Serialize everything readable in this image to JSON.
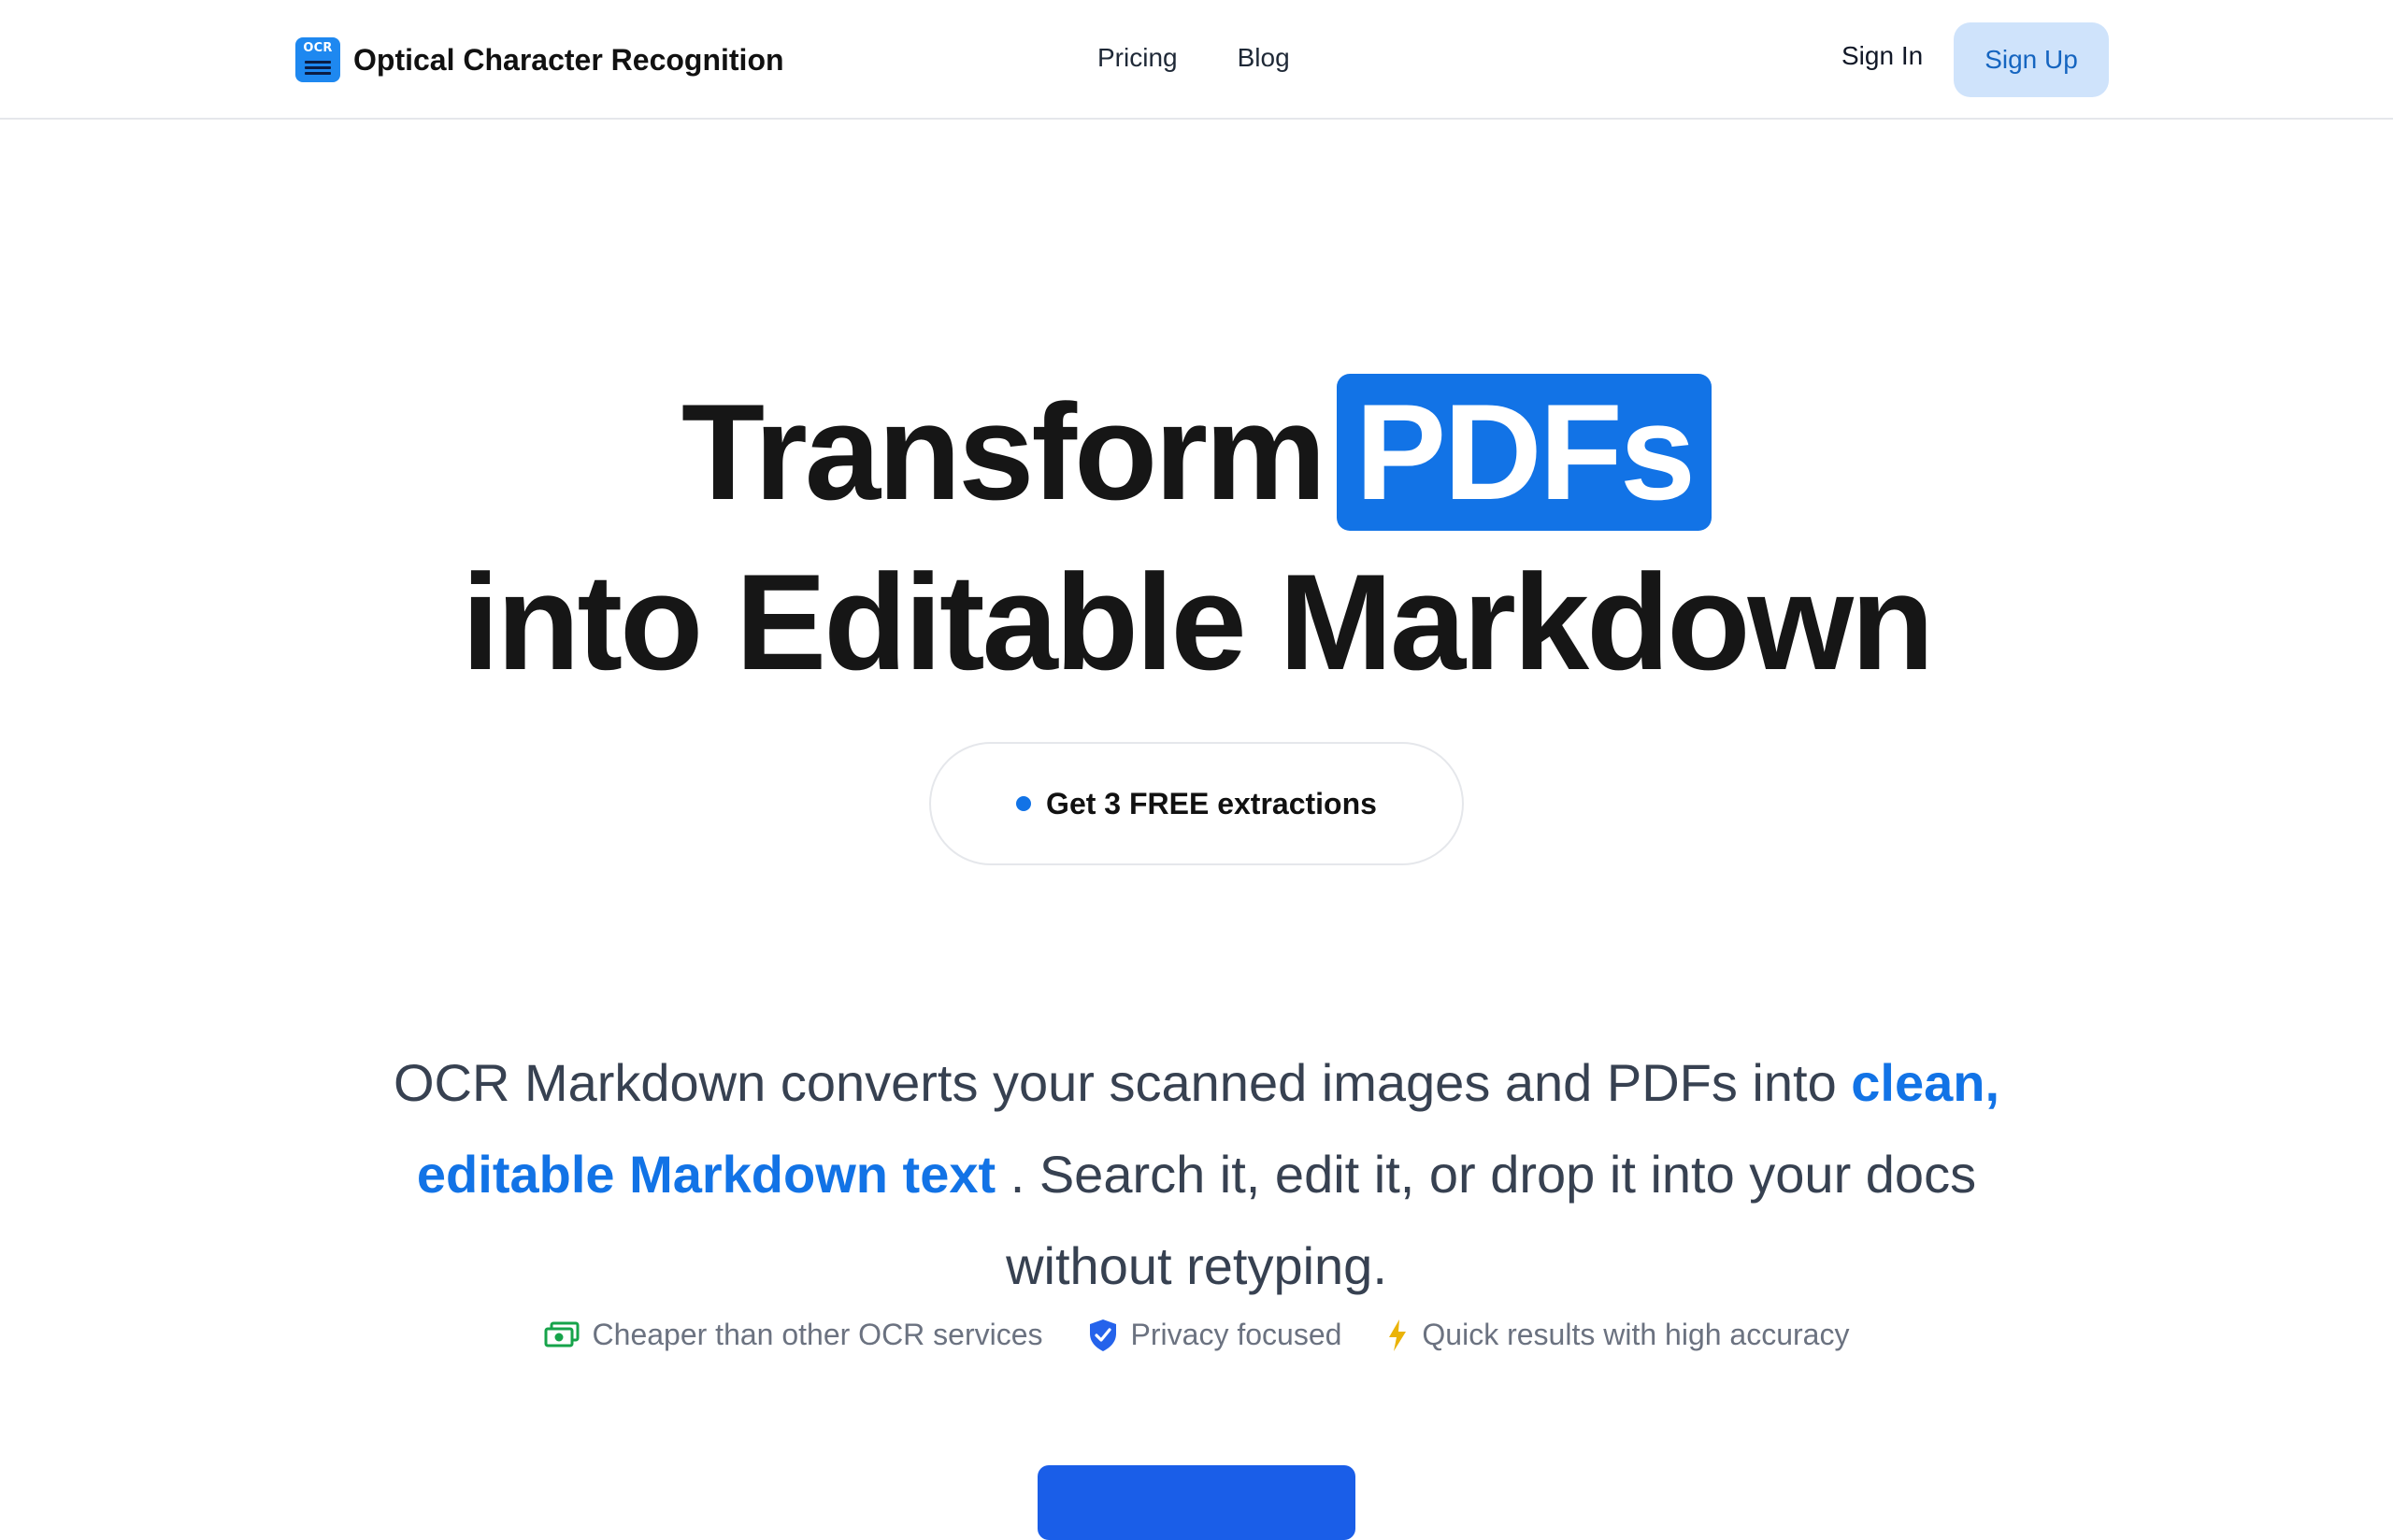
{
  "header": {
    "logo_text": "OCR",
    "brand_name": "Optical Character Recognition",
    "nav": [
      {
        "label": "Pricing"
      },
      {
        "label": "Blog"
      }
    ],
    "sign_in": "Sign In",
    "sign_up": "Sign Up"
  },
  "hero": {
    "title_part1": "Transform",
    "title_highlight": "PDFs",
    "title_line2": "into Editable Markdown",
    "cta_pill": "Get 3 FREE extractions",
    "description_before": "OCR Markdown converts your scanned images and PDFs into ",
    "description_accent": "clean, editable Markdown text",
    "description_after": " . Search it, edit it, or drop it into your docs without retyping."
  },
  "features": [
    {
      "icon": "money-icon",
      "label": "Cheaper than other OCR services",
      "color": "#16a34a"
    },
    {
      "icon": "shield-check-icon",
      "label": "Privacy focused",
      "color": "#2563eb"
    },
    {
      "icon": "lightning-icon",
      "label": "Quick results with high accuracy",
      "color": "#eab308"
    }
  ],
  "colors": {
    "accent": "#1273e6",
    "signup_bg": "#cfe3fb",
    "signup_text": "#1565c0"
  }
}
